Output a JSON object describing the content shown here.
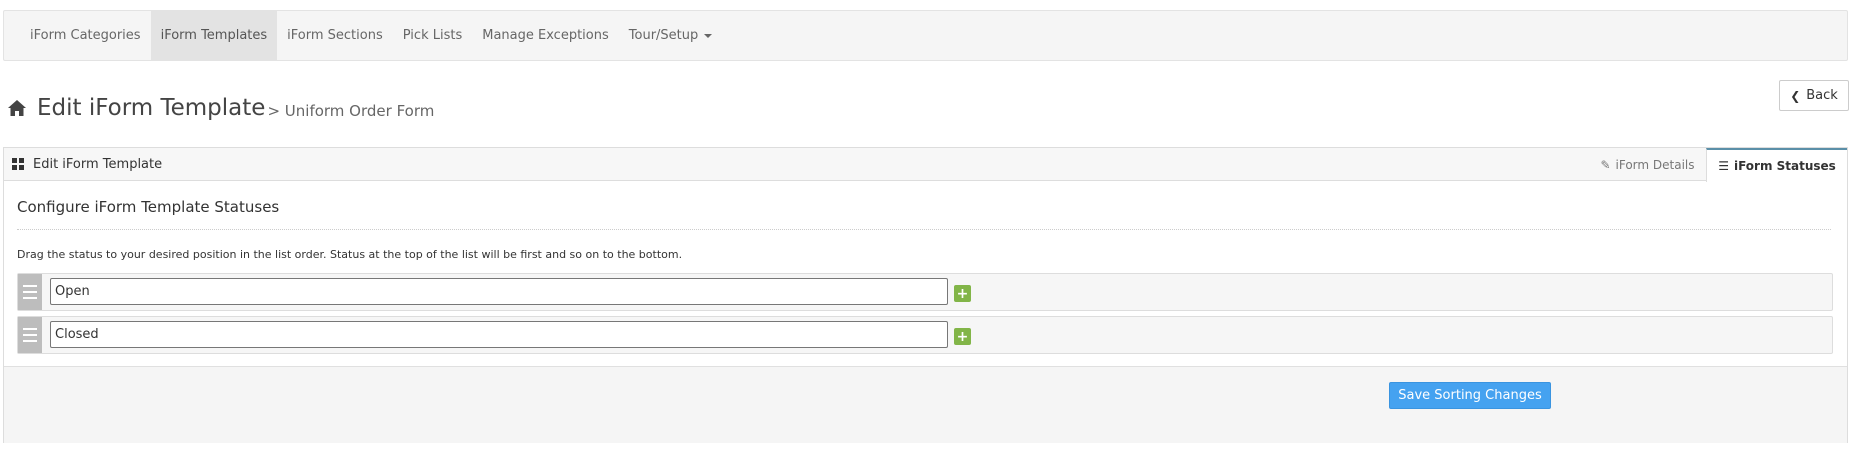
{
  "nav": {
    "items": [
      {
        "label": "iForm Categories"
      },
      {
        "label": "iForm Templates"
      },
      {
        "label": "iForm Sections"
      },
      {
        "label": "Pick Lists"
      },
      {
        "label": "Manage Exceptions"
      },
      {
        "label": "Tour/Setup"
      }
    ]
  },
  "header": {
    "title": "Edit iForm Template",
    "subtitle": "> Uniform Order Form",
    "back_label": "Back"
  },
  "panel": {
    "title": "Edit iForm Template",
    "tabs": [
      {
        "label": "iForm Details"
      },
      {
        "label": "iForm Statuses"
      }
    ],
    "section_title": "Configure iForm Template Statuses",
    "help_text": "Drag the status to your desired position in the list order. Status at the top of the list will be first and so on to the bottom.",
    "statuses": [
      {
        "value": "Open"
      },
      {
        "value": "Closed"
      }
    ],
    "save_label": "Save Sorting Changes"
  },
  "colors": {
    "primary_button": "#45a2f0",
    "add_button": "#82b548",
    "active_tab_border": "#5b8fa8"
  }
}
